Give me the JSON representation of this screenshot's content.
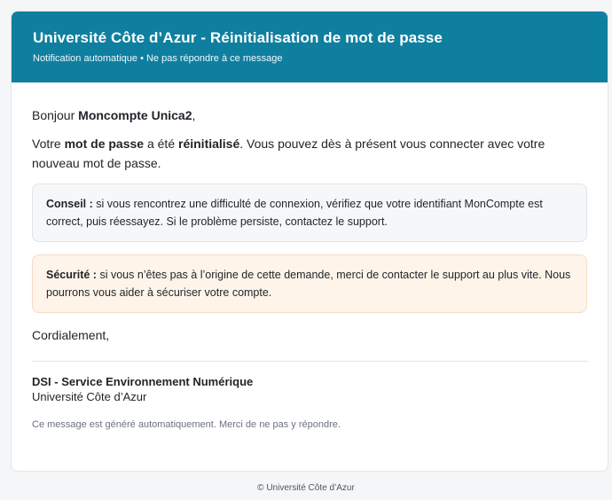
{
  "header": {
    "title": "Université Côte d’Azur - Réinitialisation de mot de passe",
    "subtitle": "Notification automatique • Ne pas répondre à ce message"
  },
  "body": {
    "greeting_prefix": "Bonjour ",
    "greeting_name": "Moncompte Unica2",
    "greeting_suffix": ",",
    "line1_prefix": "Votre ",
    "line1_bold1": "mot de passe",
    "line1_middle": " a été ",
    "line1_bold2": "réinitialisé",
    "line1_suffix": ". Vous pouvez dès à présent vous connecter avec votre nouveau mot de passe.",
    "tip_label": "Conseil :",
    "tip_text": " si vous rencontrez une difficulté de connexion, vérifiez que votre identifiant MonCompte est correct, puis réessayez. Si le problème persiste, contactez le support.",
    "security_label": "Sécurité :",
    "security_text": " si vous n’êtes pas à l’origine de cette demande, merci de contacter le support au plus vite. Nous pourrons vous aider à sécuriser votre compte.",
    "closing": "Cordialement,"
  },
  "signature": {
    "title": "DSI - Service Environnement Numérique",
    "org": "Université Côte d’Azur",
    "note": "Ce message est généré automatiquement. Merci de ne pas y répondre."
  },
  "footer": {
    "copyright": "© Université Côte d’Azur"
  },
  "colors": {
    "header_bg": "#0f7fa0",
    "tip_bg": "#f6f7f9",
    "security_bg": "#fff4ea"
  }
}
